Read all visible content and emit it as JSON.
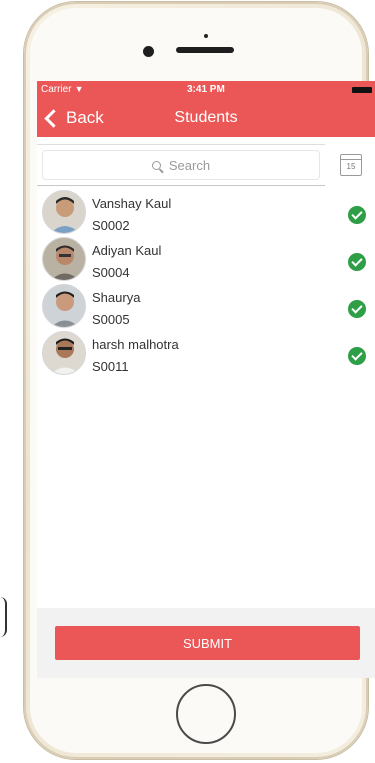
{
  "status_bar": {
    "carrier": "Carrier",
    "time": "3:41 PM"
  },
  "nav": {
    "back_label": "Back",
    "title": "Students"
  },
  "search": {
    "placeholder": "Search"
  },
  "calendar": {
    "day": "15"
  },
  "students": [
    {
      "name": "Vanshay Kaul",
      "id": "S0002",
      "present": true
    },
    {
      "name": "Adiyan Kaul",
      "id": "S0004",
      "present": true
    },
    {
      "name": "Shaurya",
      "id": "S0005",
      "present": true
    },
    {
      "name": "harsh malhotra",
      "id": "S0011",
      "present": true
    }
  ],
  "footer": {
    "submit_label": "SUBMIT"
  },
  "colors": {
    "accent": "#eb5757",
    "check": "#2e9e47"
  }
}
